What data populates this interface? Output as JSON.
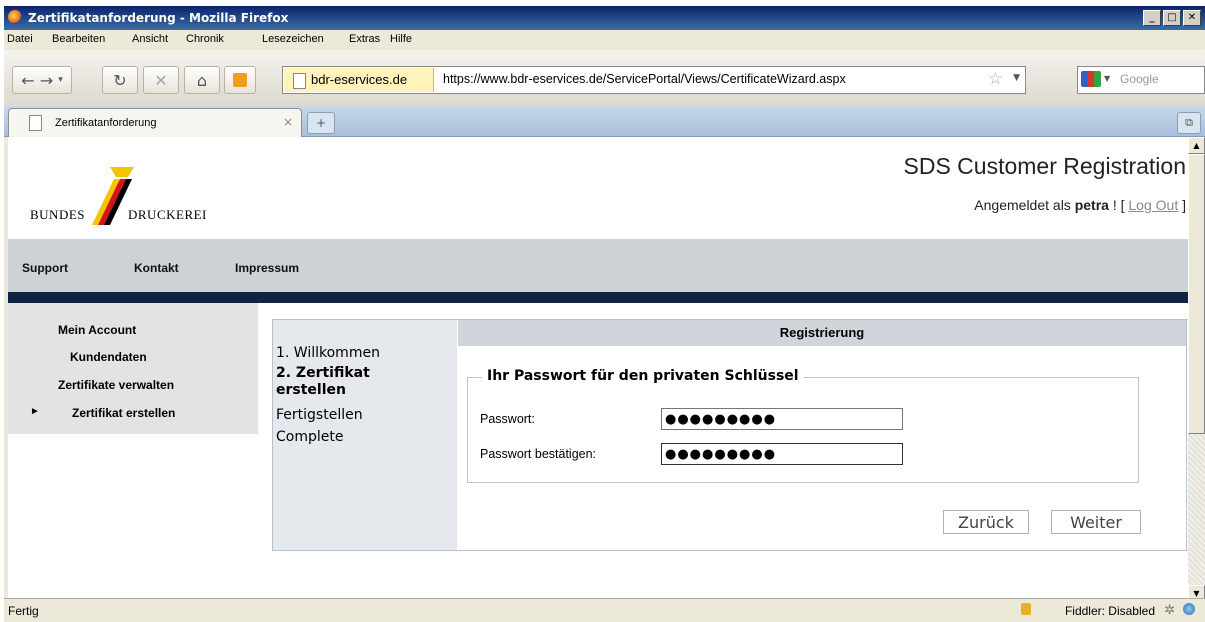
{
  "window": {
    "title": "Zertifikatanforderung - Mozilla Firefox",
    "btn_min": "_",
    "btn_max": "□",
    "btn_close": "✕"
  },
  "menu": [
    "Datei",
    "Bearbeiten",
    "Ansicht",
    "Chronik",
    "Lesezeichen",
    "Extras",
    "Hilfe"
  ],
  "toolbar": {
    "site_identity": "bdr-eservices.de",
    "url": "https://www.bdr-eservices.de/ServicePortal/Views/CertificateWizard.aspx",
    "search_placeholder": "Google"
  },
  "tab": {
    "label": "Zertifikatanforderung"
  },
  "header": {
    "logo_left": "BUNDES",
    "logo_right": "DRUCKEREI",
    "title": "SDS Customer Registration",
    "login_prefix": "Angemeldet als ",
    "username": "petra",
    "login_mid": " ! [ ",
    "logout": "Log Out",
    "login_suffix": " ]"
  },
  "topnav": [
    "Support",
    "Kontakt",
    "Impressum"
  ],
  "sidebar": [
    "Mein Account",
    "Kundendaten",
    "Zertifikate verwalten",
    "Zertifikat erstellen"
  ],
  "sidebar_active_marker": "►",
  "wizard": {
    "steps": [
      "1. Willkommen",
      "2. Zertifikat erstellen",
      "Fertigstellen",
      "Complete"
    ],
    "panel_title": "Registrierung",
    "legend": "Ihr Passwort für den privaten Schlüssel",
    "password_label": "Passwort:",
    "password_value": "●●●●●●●●●",
    "confirm_label": "Passwort bestätigen:",
    "confirm_value": "●●●●●●●●●",
    "back_button": "Zurück",
    "next_button": "Weiter"
  },
  "status": {
    "text": "Fertig",
    "fiddler": "Fiddler: Disabled"
  },
  "colors": {
    "nav_dark": "#0e2442",
    "nav_gray": "#cdd2d6",
    "logo_yellow": "#f5c400",
    "logo_red": "#d2141e"
  }
}
